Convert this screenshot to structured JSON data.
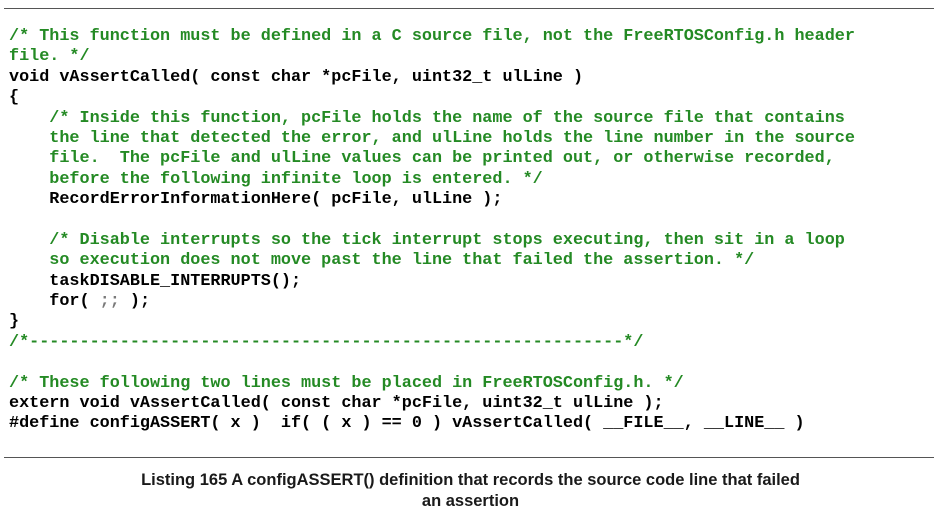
{
  "colors": {
    "comment": "#248a24",
    "code": "#000000",
    "caption": "#1a1a1a",
    "rule": "#555555"
  },
  "code_lines": [
    {
      "kind": "comment",
      "text": "/* This function must be defined in a C source file, not the FreeRTOSConfig.h header"
    },
    {
      "kind": "comment",
      "text": "file. */"
    },
    {
      "kind": "code",
      "text": "void vAssertCalled( const char *pcFile, uint32_t ulLine )"
    },
    {
      "kind": "code",
      "text": "{"
    },
    {
      "kind": "comment",
      "text": "    /* Inside this function, pcFile holds the name of the source file that contains"
    },
    {
      "kind": "comment",
      "text": "    the line that detected the error, and ulLine holds the line number in the source"
    },
    {
      "kind": "comment",
      "text": "    file.  The pcFile and ulLine values can be printed out, or otherwise recorded,"
    },
    {
      "kind": "comment",
      "text": "    before the following infinite loop is entered. */"
    },
    {
      "kind": "code",
      "text": "    RecordErrorInformationHere( pcFile, ulLine );"
    },
    {
      "kind": "blank",
      "text": ""
    },
    {
      "kind": "comment",
      "text": "    /* Disable interrupts so the tick interrupt stops executing, then sit in a loop"
    },
    {
      "kind": "comment",
      "text": "    so execution does not move past the line that failed the assertion. */"
    },
    {
      "kind": "code",
      "text": "    taskDISABLE_INTERRUPTS();"
    },
    {
      "kind": "code",
      "text": "    for( ;; );"
    },
    {
      "kind": "code",
      "text": "}"
    },
    {
      "kind": "comment",
      "text": "/*-----------------------------------------------------------*/"
    },
    {
      "kind": "blank",
      "text": ""
    },
    {
      "kind": "comment",
      "text": "/* These following two lines must be placed in FreeRTOSConfig.h. */"
    },
    {
      "kind": "code",
      "text": "extern void vAssertCalled( const char *pcFile, uint32_t ulLine );"
    },
    {
      "kind": "code",
      "text": "#define configASSERT( x )  if( ( x ) == 0 ) vAssertCalled( __FILE__, __LINE__ )"
    }
  ],
  "caption": {
    "line1": "Listing 165 A configASSERT() definition that records the source code line that failed",
    "line2": "an assertion"
  }
}
